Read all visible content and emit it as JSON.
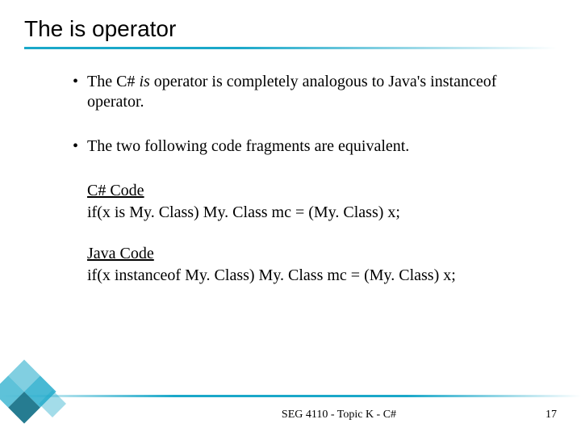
{
  "title": "The is operator",
  "bullet1_pre": "The C# ",
  "bullet1_is": "is",
  "bullet1_post": " operator is completely analogous to Java's instanceof operator.",
  "bullet2": "The two following code fragments are equivalent.",
  "csharp_label": "C# Code",
  "csharp_code": "if(x is My. Class) My. Class mc = (My. Class) x;",
  "java_label": "Java Code",
  "java_code": "if(x instanceof My. Class) My. Class mc = (My. Class) x;",
  "footer": "SEG 4110 - Topic K - C#",
  "page": "17"
}
